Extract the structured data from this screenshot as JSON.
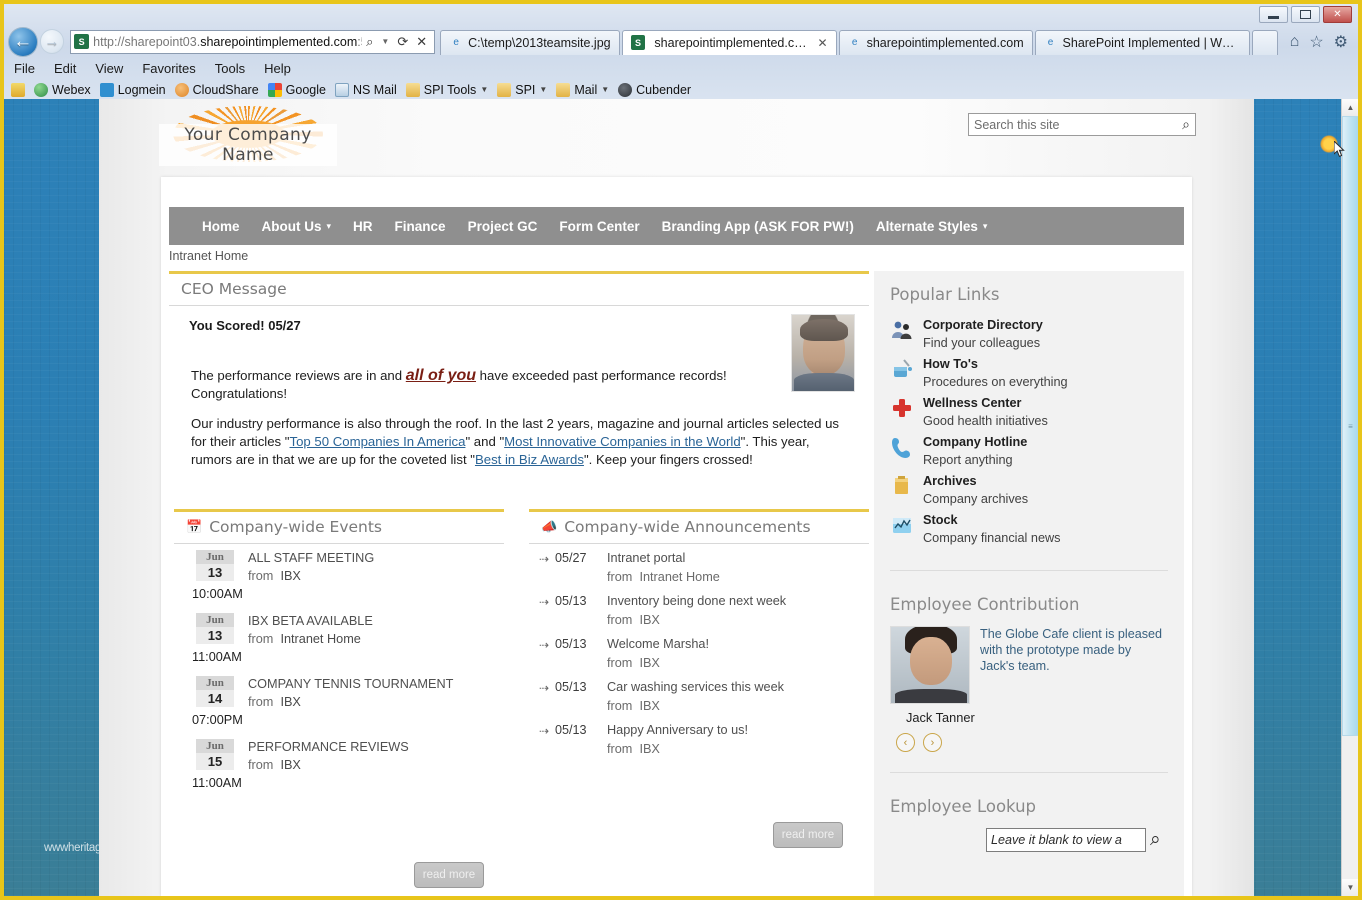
{
  "window": {
    "minimize_label": "Minimize",
    "restore_label": "Restore",
    "close_label": "✕"
  },
  "browser": {
    "address": {
      "scheme": "http://",
      "host_pre": "sharepoint03.",
      "host_bold": "sharepointimplemented.com",
      "port": ":5",
      "full": "http://sharepoint03.sharepointimplemented.com:5",
      "search_icon": "⌕",
      "refresh_icon": "⟳",
      "stop_icon": "✕"
    },
    "tabs": [
      {
        "label": "C:\\temp\\2013teamsite.jpg",
        "icon": "e",
        "active": false,
        "closable": false
      },
      {
        "label": "sharepointimplemented.com",
        "icon": "S",
        "active": true,
        "closable": true
      },
      {
        "label": "sharepointimplemented.com",
        "icon": "e",
        "active": false,
        "closable": false
      },
      {
        "label": "SharePoint Implemented | Wel...",
        "icon": "e",
        "active": false,
        "closable": false
      }
    ],
    "chrome_icons": [
      "home-icon",
      "favorites-star-icon",
      "tools-gear-icon"
    ],
    "menu": [
      "File",
      "Edit",
      "View",
      "Favorites",
      "Tools",
      "Help"
    ],
    "favorites": [
      {
        "label": "",
        "icon": "add-favorites-icon",
        "color": "#e0b32d",
        "caret": false
      },
      {
        "label": "Webex",
        "icon": "globe-icon",
        "color": "#3aa34a",
        "caret": false
      },
      {
        "label": "Logmein",
        "icon": "logmein-icon",
        "color": "#2f8fd0",
        "caret": false
      },
      {
        "label": "CloudShare",
        "icon": "cloudshare-icon",
        "color": "#e08a2e",
        "caret": false
      },
      {
        "label": "Google",
        "icon": "google-icon",
        "color": "#4285f4",
        "caret": false
      },
      {
        "label": "NS Mail",
        "icon": "document-icon",
        "color": "#6f9fc8",
        "caret": false
      },
      {
        "label": "SPI Tools",
        "icon": "folder-icon",
        "color": "#e8be56",
        "caret": true
      },
      {
        "label": "SPI",
        "icon": "folder-icon",
        "color": "#e8be56",
        "caret": true
      },
      {
        "label": "Mail",
        "icon": "folder-icon",
        "color": "#e8be56",
        "caret": true
      },
      {
        "label": "Cubender",
        "icon": "cubender-icon",
        "color": "#3a3f44",
        "caret": false
      }
    ]
  },
  "site": {
    "logo_text": "Your Company Name",
    "search_placeholder": "Search this site",
    "search_value": "",
    "breadcrumb": "Intranet Home",
    "nav": [
      {
        "label": "Home",
        "caret": false
      },
      {
        "label": "About Us",
        "caret": true
      },
      {
        "label": "HR",
        "caret": false
      },
      {
        "label": "Finance",
        "caret": false
      },
      {
        "label": "Project GC",
        "caret": false
      },
      {
        "label": "Form Center",
        "caret": false
      },
      {
        "label": "Branding App (ASK FOR PW!)",
        "caret": false
      },
      {
        "label": "Alternate Styles",
        "caret": true
      }
    ],
    "watermark": "wwwheritag"
  },
  "ceo": {
    "title": "CEO Message",
    "score_line": "You Scored! 05/27",
    "para1_before": "The performance reviews are in and ",
    "para1_emph": "all of you",
    "para1_after": " have exceeded past performance records! Congratulations!",
    "para2_a": "Our industry performance is also through the roof. In the last 2 years, magazine and journal articles selected us for their articles \"",
    "link1": "Top 50 Companies In America",
    "para2_b": "\" and \"",
    "link2": "Most Innovative Companies in the World",
    "para2_c": "\". This year, rumors are in that we are up for the coveted list \"",
    "link3": "Best in Biz Awards",
    "para2_d": "\". Keep your fingers crossed!"
  },
  "events": {
    "title": "Company-wide Events",
    "icon": "calendar-icon",
    "read_more": "read more",
    "items": [
      {
        "month": "Jun",
        "day": "13",
        "title": "ALL STAFF MEETING",
        "from_label": "from",
        "from": "IBX",
        "time": "10:00AM"
      },
      {
        "month": "Jun",
        "day": "13",
        "title": "IBX BETA AVAILABLE",
        "from_label": "from",
        "from": "Intranet Home",
        "time": "11:00AM"
      },
      {
        "month": "Jun",
        "day": "14",
        "title": "COMPANY TENNIS TOURNAMENT",
        "from_label": "from",
        "from": "IBX",
        "time": "07:00PM"
      },
      {
        "month": "Jun",
        "day": "15",
        "title": "PERFORMANCE REVIEWS",
        "from_label": "from",
        "from": "IBX",
        "time": "11:00AM"
      }
    ]
  },
  "announcements": {
    "title": "Company-wide Announcements",
    "icon": "megaphone-icon",
    "read_more": "read more",
    "items": [
      {
        "date": "05/27",
        "title": "Intranet portal",
        "from_label": "from",
        "from": "Intranet Home"
      },
      {
        "date": "05/13",
        "title": "Inventory being done next week",
        "from_label": "from",
        "from": "IBX"
      },
      {
        "date": "05/13",
        "title": "Welcome Marsha!",
        "from_label": "from",
        "from": "IBX"
      },
      {
        "date": "05/13",
        "title": "Car washing services this week",
        "from_label": "from",
        "from": "IBX"
      },
      {
        "date": "05/13",
        "title": "Happy Anniversary to us!",
        "from_label": "from",
        "from": "IBX"
      }
    ]
  },
  "popular_links": {
    "title": "Popular Links",
    "items": [
      {
        "title": "Corporate Directory",
        "subtitle": "Find your colleagues",
        "icon": "people-icon",
        "color": "#4a6fa5"
      },
      {
        "title": "How To's",
        "subtitle": "Procedures on everything",
        "icon": "paint-bucket-icon",
        "color": "#5aa7d4"
      },
      {
        "title": "Wellness Center",
        "subtitle": "Good health initiatives",
        "icon": "red-cross-icon",
        "color": "#d7342e"
      },
      {
        "title": "Company Hotline",
        "subtitle": "Report anything",
        "icon": "phone-icon",
        "color": "#4fa3d8"
      },
      {
        "title": "Archives",
        "subtitle": "Company archives",
        "icon": "folder-icon",
        "color": "#e8b84b"
      },
      {
        "title": "Stock",
        "subtitle": "Company financial news",
        "icon": "chart-icon",
        "color": "#5fa9d6"
      }
    ]
  },
  "employee_contribution": {
    "title": "Employee Contribution",
    "text": "The Globe Cafe client is pleased with the prototype made by Jack's team.",
    "name": "Jack Tanner",
    "prev_label": "‹",
    "next_label": "›"
  },
  "employee_lookup": {
    "title": "Employee Lookup",
    "placeholder": "Leave it blank to view a",
    "value": "",
    "search_icon": "search-icon"
  },
  "scrollbar": {
    "up_arrow": "▲",
    "down_arrow": "▼",
    "grip": "≡"
  },
  "colors": {
    "accent_yellow": "#e8c84a",
    "nav_gray": "#8f8f8f",
    "page_bg_blue": "#2a7fb5",
    "link_blue": "#2a6496",
    "emph_red": "#7a1f14"
  }
}
